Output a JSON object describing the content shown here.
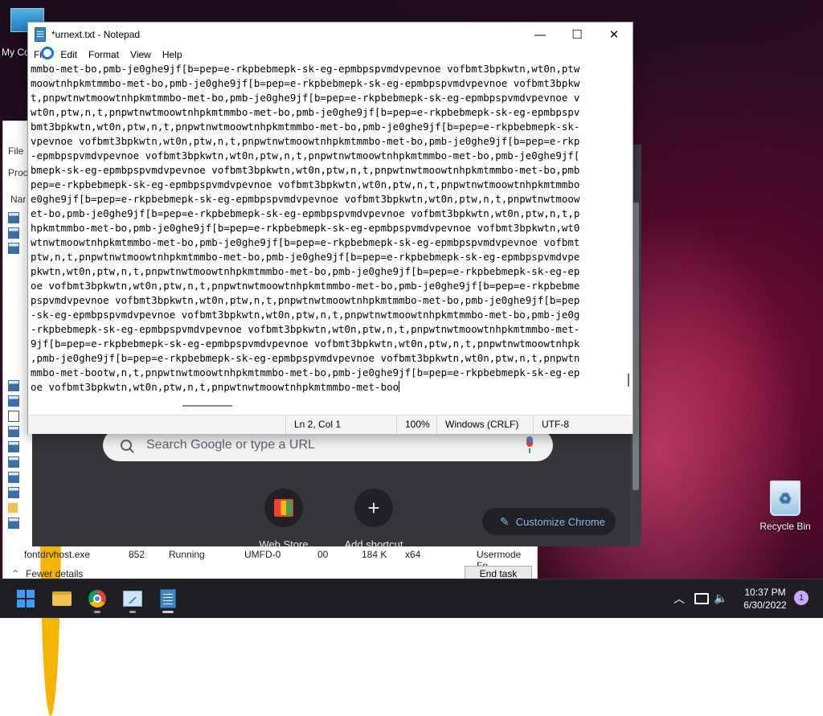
{
  "desktop": {
    "my_computer_label": "My Co",
    "recycle_bin_label": "Recycle Bin"
  },
  "task_manager": {
    "menu_file": "File",
    "tab_partial": "Proc",
    "col_partial": "Nar",
    "row_icons": [
      "app",
      "app",
      "app",
      "chrome",
      "chrome",
      "chrome",
      "chrome",
      "chrome",
      "chrome",
      "chrome",
      "chrome",
      "app",
      "app",
      "pen",
      "app",
      "app",
      "app",
      "app",
      "app",
      "folder",
      "app"
    ],
    "visible_row": {
      "name": "fontdrvhost.exe",
      "pid": "852",
      "status": "Running",
      "user": "UMFD-0",
      "cpu": "00",
      "memory": "184 K",
      "arch": "x64",
      "description": "Usermode Fo"
    },
    "fewer_details": "Fewer details",
    "end_task": "End task"
  },
  "chrome_ntp": {
    "search_placeholder": "Search Google or type a URL",
    "shortcut_web_store": "Web Store",
    "shortcut_add": "Add shortcut",
    "customize_label": "Customize Chrome"
  },
  "notepad": {
    "title": "*urnext.txt - Notepad",
    "menu": [
      "File",
      "Edit",
      "Format",
      "View",
      "Help"
    ],
    "lines": [
      "mmbo-met-bo,pmb-je0ghe9jf[b=pep=e-rkpbebmepk-sk-eg-epmbpspvmdvpevnoe vofbmt3bpkwtn,wt0n,ptw",
      "moowtnhpkmtmmbo-met-bo,pmb-je0ghe9jf[b=pep=e-rkpbebmepk-sk-eg-epmbpspvmdvpevnoe vofbmt3bpkw",
      "t,pnpwtnwtmoowtnhpkmtmmbo-met-bo,pmb-je0ghe9jf[b=pep=e-rkpbebmepk-sk-eg-epmbpspvmdvpevnoe v",
      "wt0n,ptw,n,t,pnpwtnwtmoowtnhpkmtmmbo-met-bo,pmb-je0ghe9jf[b=pep=e-rkpbebmepk-sk-eg-epmbpspv",
      "bmt3bpkwtn,wt0n,ptw,n,t,pnpwtnwtmoowtnhpkmtmmbo-met-bo,pmb-je0ghe9jf[b=pep=e-rkpbebmepk-sk-",
      "vpevnoe vofbmt3bpkwtn,wt0n,ptw,n,t,pnpwtnwtmoowtnhpkmtmmbo-met-bo,pmb-je0ghe9jf[b=pep=e-rkp",
      "-epmbpspvmdvpevnoe vofbmt3bpkwtn,wt0n,ptw,n,t,pnpwtnwtmoowtnhpkmtmmbo-met-bo,pmb-je0ghe9jf[",
      "bmepk-sk-eg-epmbpspvmdvpevnoe vofbmt3bpkwtn,wt0n,ptw,n,t,pnpwtnwtmoowtnhpkmtmmbo-met-bo,pmb",
      "pep=e-rkpbebmepk-sk-eg-epmbpspvmdvpevnoe vofbmt3bpkwtn,wt0n,ptw,n,t,pnpwtnwtmoowtnhpkmtmmbo",
      "e0ghe9jf[b=pep=e-rkpbebmepk-sk-eg-epmbpspvmdvpevnoe vofbmt3bpkwtn,wt0n,ptw,n,t,pnpwtnwtmoow",
      "et-bo,pmb-je0ghe9jf[b=pep=e-rkpbebmepk-sk-eg-epmbpspvmdvpevnoe vofbmt3bpkwtn,wt0n,ptw,n,t,p",
      "hpkmtmmbo-met-bo,pmb-je0ghe9jf[b=pep=e-rkpbebmepk-sk-eg-epmbpspvmdvpevnoe vofbmt3bpkwtn,wt0",
      "wtnwtmoowtnhpkmtmmbo-met-bo,pmb-je0ghe9jf[b=pep=e-rkpbebmepk-sk-eg-epmbpspvmdvpevnoe vofbmt",
      "ptw,n,t,pnpwtnwtmoowtnhpkmtmmbo-met-bo,pmb-je0ghe9jf[b=pep=e-rkpbebmepk-sk-eg-epmbpspvmdvpe",
      "pkwtn,wt0n,ptw,n,t,pnpwtnwtmoowtnhpkmtmmbo-met-bo,pmb-je0ghe9jf[b=pep=e-rkpbebmepk-sk-eg-ep",
      "oe vofbmt3bpkwtn,wt0n,ptw,n,t,pnpwtnwtmoowtnhpkmtmmbo-met-bo,pmb-je0ghe9jf[b=pep=e-rkpbebme",
      "pspvmdvpevnoe vofbmt3bpkwtn,wt0n,ptw,n,t,pnpwtnwtmoowtnhpkmtmmbo-met-bo,pmb-je0ghe9jf[b=pep",
      "-sk-eg-epmbpspvmdvpevnoe vofbmt3bpkwtn,wt0n,ptw,n,t,pnpwtnwtmoowtnhpkmtmmbo-met-bo,pmb-je0g",
      "-rkpbebmepk-sk-eg-epmbpspvmdvpevnoe vofbmt3bpkwtn,wt0n,ptw,n,t,pnpwtnwtmoowtnhpkmtmmbo-met-",
      "9jf[b=pep=e-rkpbebmepk-sk-eg-epmbpspvmdvpevnoe vofbmt3bpkwtn,wt0n,ptw,n,t,pnpwtnwtmoowtnhpk",
      ",pmb-je0ghe9jf[b=pep=e-rkpbebmepk-sk-eg-epmbpspvmdvpevnoe vofbmt3bpkwtn,wt0n,ptw,n,t,pnpwtn",
      "mmbo-met-bootw,n,t,pnpwtnwtmoowtnhpkmtmmbo-met-bo,pmb-je0ghe9jf[b=pep=e-rkpbebmepk-sk-eg-ep",
      "oe vofbmt3bpkwtn,wt0n,ptw,n,t,pnpwtnwtmoowtnhpkmtmmbo-met-boo"
    ],
    "status": {
      "position": "Ln 2, Col 1",
      "zoom": "100%",
      "line_ending": "Windows (CRLF)",
      "encoding": "UTF-8"
    }
  },
  "taskbar": {
    "clock_time": "10:37 PM",
    "clock_date": "6/30/2022",
    "notification_count": "1"
  }
}
